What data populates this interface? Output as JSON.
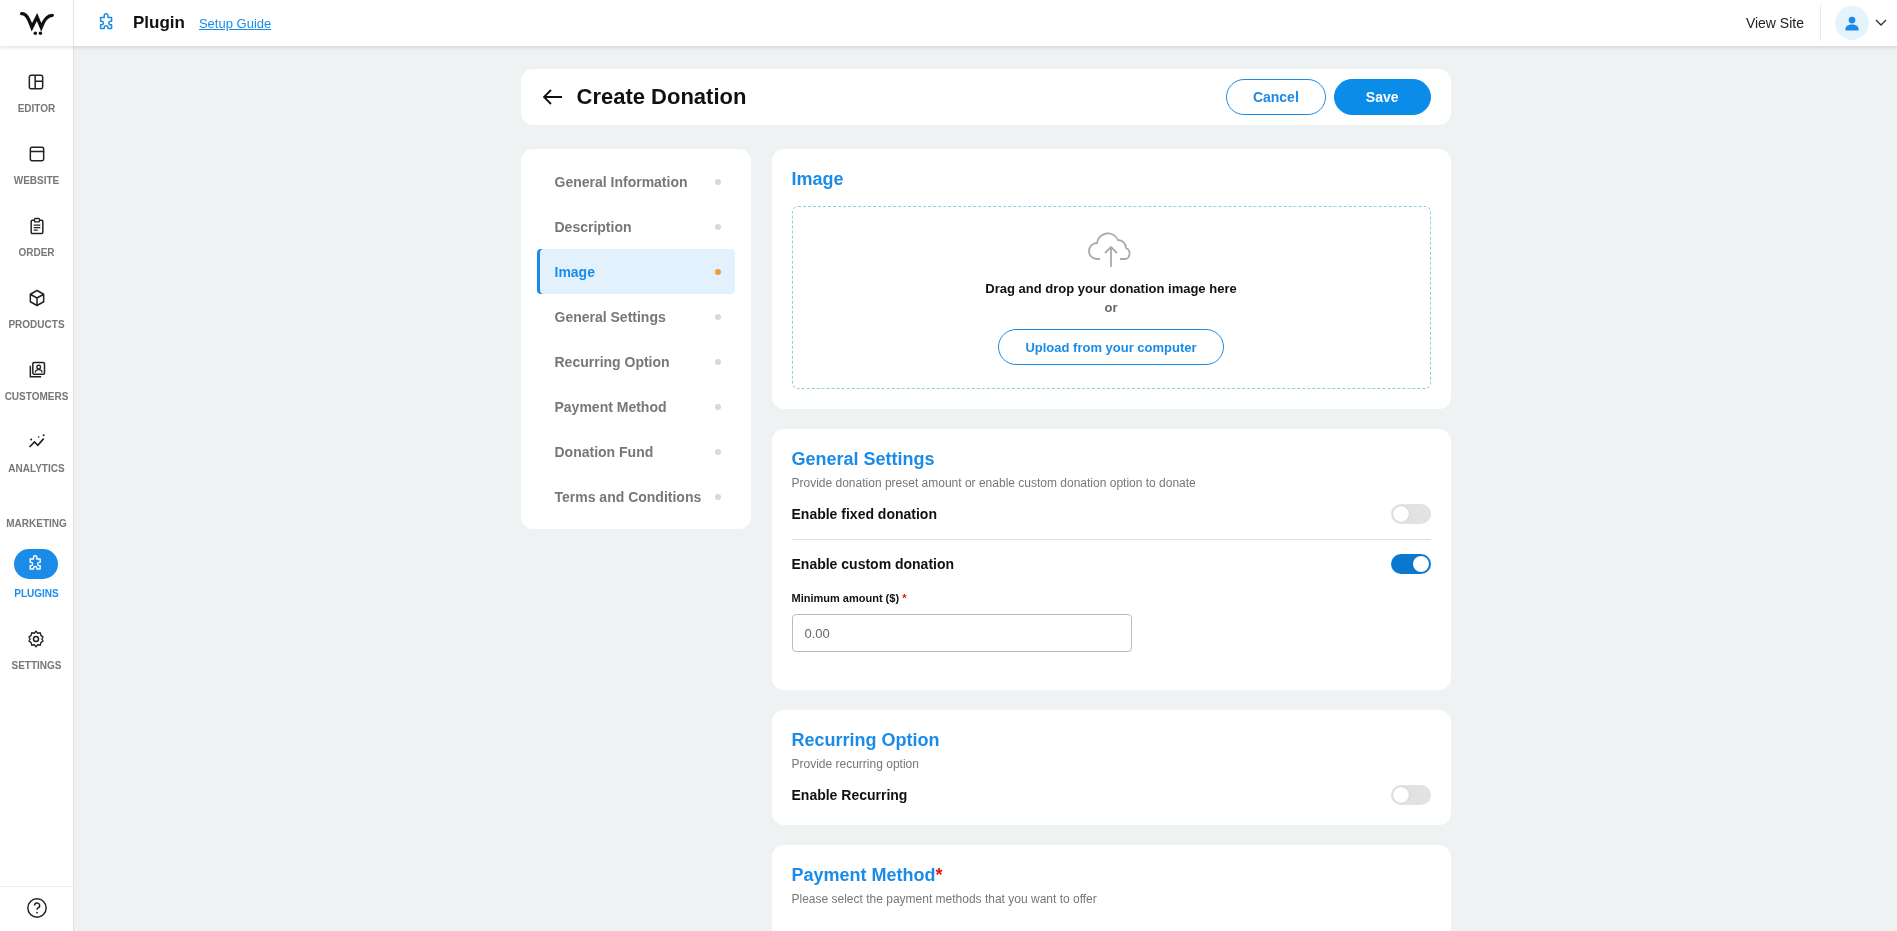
{
  "topbar": {
    "title": "Plugin",
    "setup_link": "Setup Guide",
    "view_site": "View Site"
  },
  "sidebar": {
    "items": [
      {
        "label": "EDITOR",
        "kind": "link",
        "selected": false
      },
      {
        "label": "WEBSITE",
        "kind": "link",
        "selected": false
      },
      {
        "label": "ORDER",
        "kind": "link",
        "selected": false
      },
      {
        "label": "PRODUCTS",
        "kind": "link",
        "selected": false
      },
      {
        "label": "CUSTOMERS",
        "kind": "link",
        "selected": false
      },
      {
        "label": "ANALYTICS",
        "kind": "link",
        "selected": false
      },
      {
        "label": "MARKETING",
        "kind": "section",
        "selected": false
      },
      {
        "label": "PLUGINS",
        "kind": "link",
        "selected": true
      },
      {
        "label": "SETTINGS",
        "kind": "link",
        "selected": false
      }
    ]
  },
  "header": {
    "title": "Create Donation",
    "buttons": [
      {
        "label": "Cancel",
        "kind": "secondary"
      },
      {
        "label": "Save",
        "kind": "primary"
      }
    ]
  },
  "section_nav": [
    {
      "label": "General Information",
      "selected": false
    },
    {
      "label": "Description",
      "selected": false
    },
    {
      "label": "Image",
      "selected": true
    },
    {
      "label": "General Settings",
      "selected": false
    },
    {
      "label": "Recurring Option",
      "selected": false
    },
    {
      "label": "Payment Method",
      "selected": false
    },
    {
      "label": "Donation Fund",
      "selected": false
    },
    {
      "label": "Terms and Conditions",
      "selected": false
    }
  ],
  "image_card": {
    "title": "Image",
    "drop_text": "Drag and drop your donation image here",
    "or": "or",
    "upload_button": "Upload from your computer"
  },
  "general_settings": {
    "title": "General Settings",
    "description": "Provide donation preset amount or enable custom donation option to donate",
    "toggles": [
      {
        "label": "Enable fixed donation",
        "on": false
      },
      {
        "label": "Enable custom donation",
        "on": true
      }
    ],
    "minimum_amount": {
      "label": "Minimum amount ($)",
      "required_mark": "*",
      "placeholder": "0.00"
    }
  },
  "recurring_option": {
    "title": "Recurring Option",
    "description": "Provide recurring option",
    "toggle": {
      "label": "Enable Recurring",
      "on": false
    }
  },
  "payment_method": {
    "title": "Payment Method",
    "required_mark": "*",
    "description": "Please select the payment methods that you want to offer"
  }
}
